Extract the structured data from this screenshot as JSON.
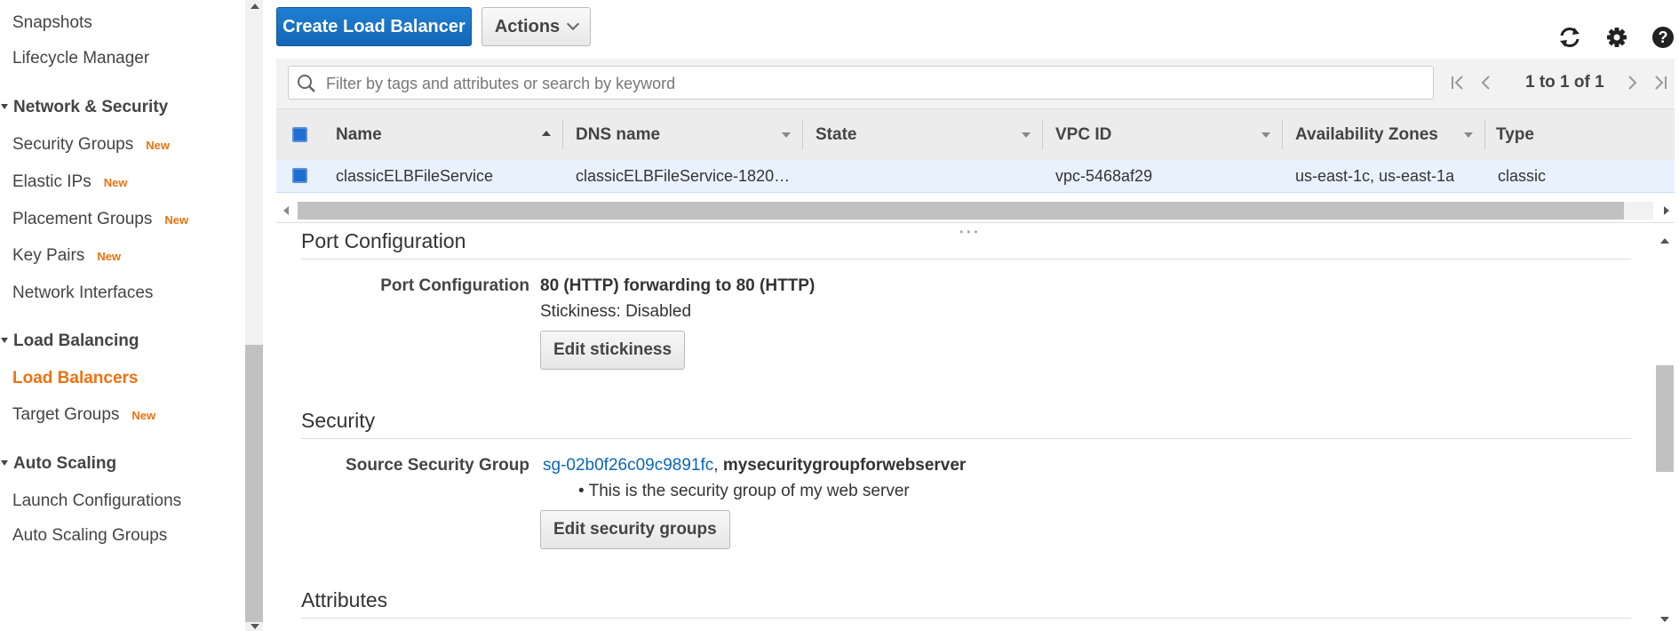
{
  "sidebar": {
    "items_top": [
      {
        "label": "Snapshots"
      },
      {
        "label": "Lifecycle Manager"
      }
    ],
    "sections": [
      {
        "title": "Network & Security"
      },
      {
        "title": "Load Balancing"
      },
      {
        "title": "Auto Scaling"
      }
    ],
    "network_items": [
      {
        "label": "Security Groups",
        "badge": "New"
      },
      {
        "label": "Elastic IPs",
        "badge": "New"
      },
      {
        "label": "Placement Groups",
        "badge": "New"
      },
      {
        "label": "Key Pairs",
        "badge": "New"
      },
      {
        "label": "Network Interfaces"
      }
    ],
    "lb_items": [
      {
        "label": "Load Balancers",
        "active": true
      },
      {
        "label": "Target Groups",
        "badge": "New"
      }
    ],
    "as_items": [
      {
        "label": "Launch Configurations"
      },
      {
        "label": "Auto Scaling Groups"
      }
    ]
  },
  "toolbar": {
    "create_label": "Create Load Balancer",
    "actions_label": "Actions",
    "icons": [
      "refresh-icon",
      "gear-icon",
      "help-icon"
    ]
  },
  "search": {
    "placeholder": "Filter by tags and attributes or search by keyword",
    "value": ""
  },
  "pager": {
    "text": "1 to 1 of 1"
  },
  "table": {
    "columns": [
      "Name",
      "DNS name",
      "State",
      "VPC ID",
      "Availability Zones",
      "Type"
    ],
    "rows": [
      {
        "name": "classicELBFileService",
        "dns": "classicELBFileService-1820…",
        "state": "",
        "vpc": "vpc-5468af29",
        "zones": "us-east-1c, us-east-1a",
        "type": "classic"
      }
    ]
  },
  "details": {
    "port_section": "Port Configuration",
    "port_label": "Port Configuration",
    "port_value": "80 (HTTP) forwarding to 80 (HTTP)",
    "stickiness": "Stickiness: Disabled",
    "edit_stickiness": "Edit stickiness",
    "security_section": "Security",
    "ssg_label": "Source Security Group",
    "ssg_link": "sg-02b0f26c09c9891fc",
    "ssg_sep": ",",
    "ssg_name": "mysecuritygroupforwebserver",
    "ssg_note": "• This is the security group of my web server",
    "edit_security": "Edit security groups",
    "attributes_section": "Attributes"
  },
  "colors": {
    "accent": "#ec7211",
    "primary": "#1f7fd1",
    "link": "#0a66b7"
  }
}
